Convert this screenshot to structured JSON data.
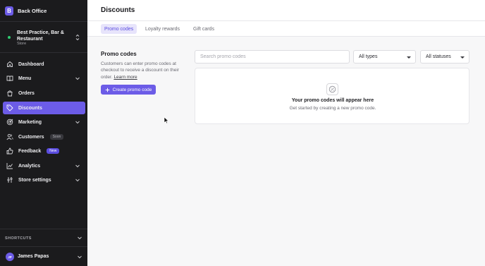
{
  "brand": {
    "logo_letter": "B",
    "name": "Back Office"
  },
  "store": {
    "name": "Best Practice, Bar & Restaurant",
    "type": "Store"
  },
  "nav": [
    {
      "label": "Dashboard",
      "icon": "home-icon",
      "chevron": false,
      "active": false
    },
    {
      "label": "Menu",
      "icon": "book-icon",
      "chevron": true,
      "active": false
    },
    {
      "label": "Orders",
      "icon": "bag-icon",
      "chevron": false,
      "active": false
    },
    {
      "label": "Discounts",
      "icon": "tag-icon",
      "chevron": false,
      "active": true
    },
    {
      "label": "Marketing",
      "icon": "target-icon",
      "chevron": true,
      "active": false
    },
    {
      "label": "Customers",
      "icon": "users-icon",
      "badge": "Soon",
      "chevron": false,
      "active": false
    },
    {
      "label": "Feedback",
      "icon": "thumbs-up-icon",
      "badge": "New",
      "chevron": false,
      "active": false
    },
    {
      "label": "Analytics",
      "icon": "chart-icon",
      "chevron": true,
      "active": false
    },
    {
      "label": "Store settings",
      "icon": "settings-icon",
      "chevron": true,
      "active": false
    }
  ],
  "shortcuts": {
    "label": "SHORTCUTS"
  },
  "user": {
    "initials": "JP",
    "name": "James Papas"
  },
  "header": {
    "title": "Discounts"
  },
  "tabs": [
    {
      "label": "Promo codes",
      "active": true
    },
    {
      "label": "Loyalty rewards",
      "active": false
    },
    {
      "label": "Gift cards",
      "active": false
    }
  ],
  "promo": {
    "title": "Promo codes",
    "description": "Customers can enter promo codes at checkout to receive a discount on their order.",
    "learn_more": "Learn more",
    "create_label": "Create promo code"
  },
  "filters": {
    "search_placeholder": "Search promo codes",
    "types_value": "All types",
    "statuses_value": "All statuses"
  },
  "empty_state": {
    "title": "Your promo codes will appear here",
    "subtitle": "Get started by creating a new promo code."
  },
  "colors": {
    "accent": "#6c5ce7",
    "sidebar_bg": "#1b1b1d",
    "status_online": "#2ecc71"
  }
}
